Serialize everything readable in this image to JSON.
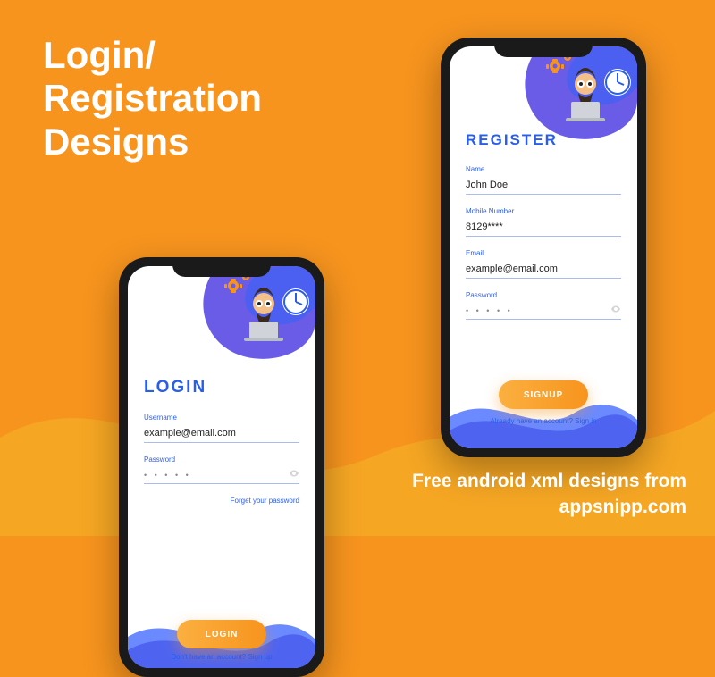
{
  "headline_line1": "Login/",
  "headline_line2": "Registration",
  "headline_line3": "Designs",
  "footer_line1": "Free android xml designs from",
  "footer_line2": "appsnipp.com",
  "login": {
    "title": "LOGIN",
    "username_label": "Username",
    "username_value": "example@email.com",
    "password_label": "Password",
    "password_value": "• • • • •",
    "forgot_link": "Forget your password",
    "button": "LOGIN",
    "signup_link": "Don't have an account? Sign up"
  },
  "register": {
    "title": "REGISTER",
    "name_label": "Name",
    "name_value": "John Doe",
    "mobile_label": "Mobile Number",
    "mobile_value": "8129****",
    "email_label": "Email",
    "email_value": "example@email.com",
    "password_label": "Password",
    "password_value": "• • • • •",
    "button": "SIGNUP",
    "signin_link": "Already have an account? Sign in"
  }
}
